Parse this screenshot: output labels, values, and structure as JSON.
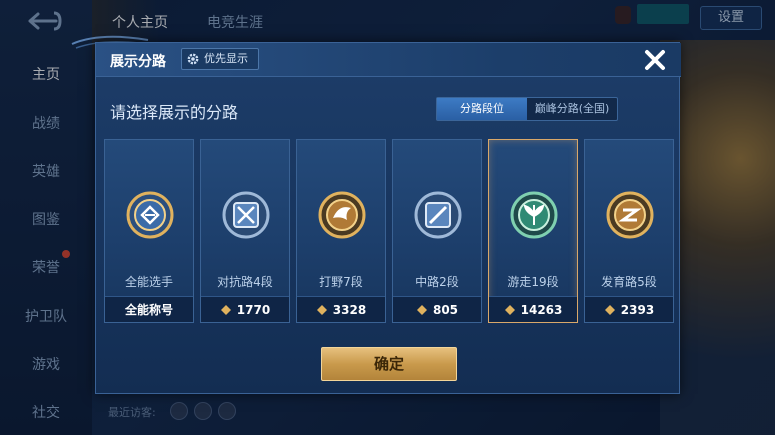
{
  "sidebar": {
    "items": [
      {
        "label": "主页",
        "active": true
      },
      {
        "label": "战绩",
        "active": false
      },
      {
        "label": "英雄",
        "active": false
      },
      {
        "label": "图鉴",
        "active": false
      },
      {
        "label": "荣誉",
        "active": false
      },
      {
        "label": "护卫队",
        "active": false
      },
      {
        "label": "游戏",
        "active": false
      },
      {
        "label": "社交",
        "active": false
      }
    ]
  },
  "topbar": {
    "tabs": [
      "个人主页",
      "电竞生涯"
    ],
    "settings_label": "设置"
  },
  "bottom": {
    "visitors_label": "最近访客:"
  },
  "modal": {
    "title": "展示分路",
    "priority_label": "优先显示",
    "subtitle": "请选择展示的分路",
    "segments": [
      {
        "label": "分路段位",
        "active": true
      },
      {
        "label": "巅峰分路(全国)",
        "active": false
      }
    ],
    "cards": [
      {
        "name": "全能选手",
        "foot": "全能称号",
        "selected": false,
        "emblem": "all-round-emblem-icon",
        "show_rank_icon": false
      },
      {
        "name": "对抗路4段",
        "foot": "1770",
        "selected": false,
        "emblem": "clash-lane-emblem-icon",
        "show_rank_icon": true
      },
      {
        "name": "打野7段",
        "foot": "3328",
        "selected": false,
        "emblem": "jungle-emblem-icon",
        "show_rank_icon": true
      },
      {
        "name": "中路2段",
        "foot": "805",
        "selected": false,
        "emblem": "mid-lane-emblem-icon",
        "show_rank_icon": true
      },
      {
        "name": "游走19段",
        "foot": "14263",
        "selected": true,
        "emblem": "roam-emblem-icon",
        "show_rank_icon": true
      },
      {
        "name": "发育路5段",
        "foot": "2393",
        "selected": false,
        "emblem": "farm-lane-emblem-icon",
        "show_rank_icon": true
      }
    ],
    "confirm_label": "确定"
  },
  "colors": {
    "accent_blue": "#2a5fa4",
    "selected_border": "#d9a86a",
    "confirm_gold": "#c99a4c"
  }
}
